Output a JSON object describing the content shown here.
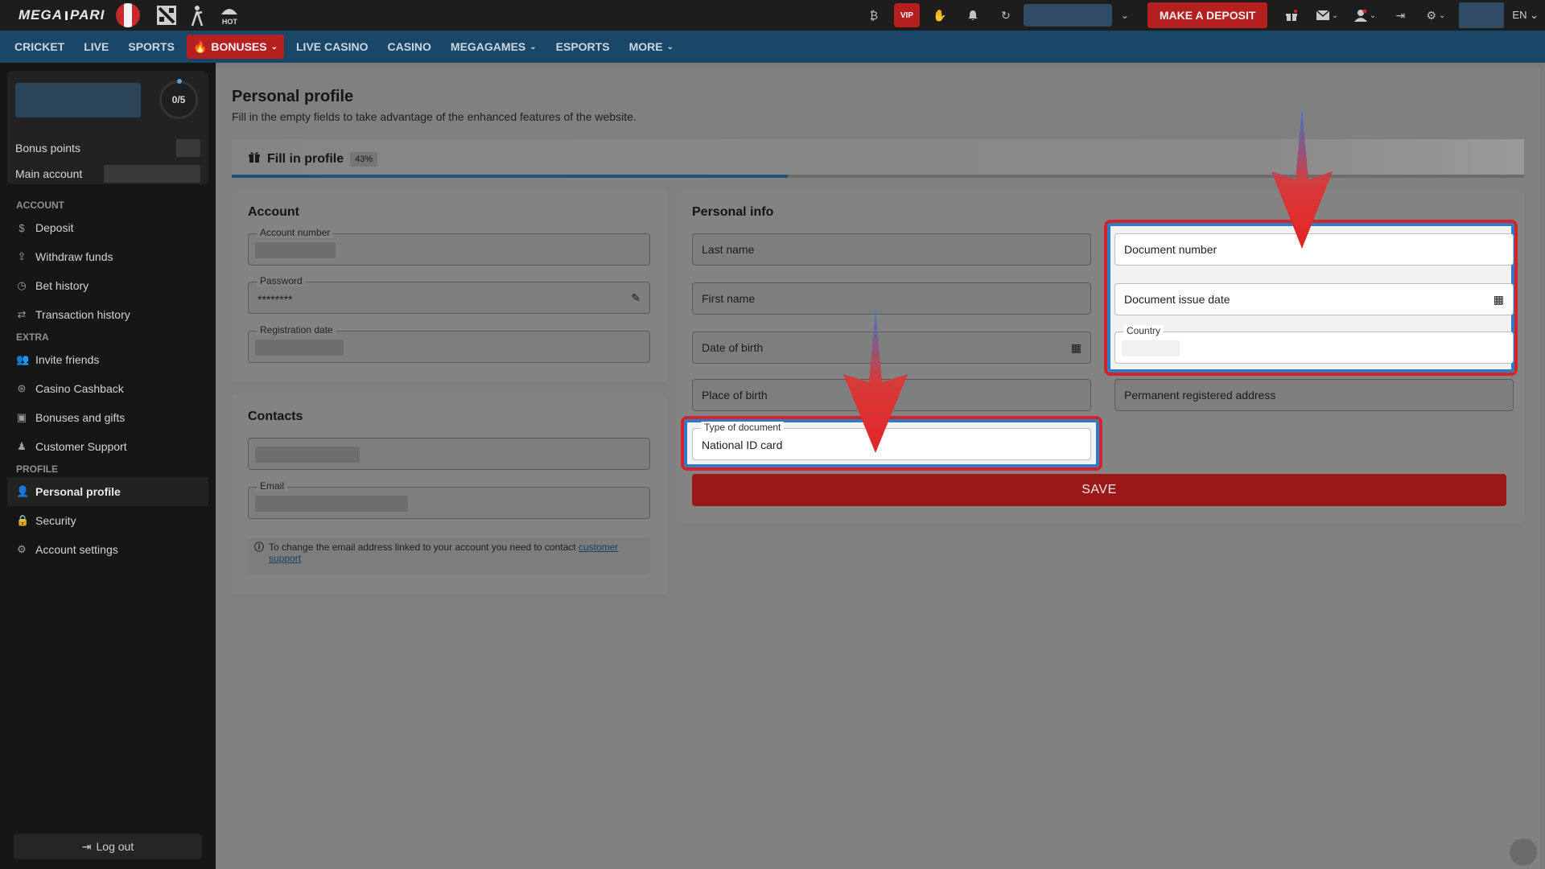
{
  "brand": {
    "logo_left": "MEGA",
    "logo_right": "PARI",
    "hot_label": "HOT"
  },
  "topbar": {
    "deposit_label": "MAKE A DEPOSIT",
    "vip_label": "VIP",
    "language": "EN",
    "icons": [
      "bitcoin-icon",
      "vip-icon",
      "hand-icon",
      "bell-icon",
      "refresh-icon",
      "gift-icon",
      "mail-icon",
      "user-icon",
      "logout-icon",
      "gear-icon"
    ]
  },
  "nav": {
    "items": [
      {
        "label": "CRICKET"
      },
      {
        "label": "LIVE"
      },
      {
        "label": "SPORTS"
      },
      {
        "label": "BONUSES",
        "active": true
      },
      {
        "label": "LIVE CASINO"
      },
      {
        "label": "CASINO"
      },
      {
        "label": "MEGAGAMES"
      },
      {
        "label": "ESPORTS"
      },
      {
        "label": "MORE"
      }
    ]
  },
  "sidebar": {
    "progress": "0/5",
    "bonus_points_label": "Bonus points",
    "main_account_label": "Main account",
    "sections": [
      {
        "title": "ACCOUNT",
        "items": [
          "Deposit",
          "Withdraw funds",
          "Bet history",
          "Transaction history"
        ]
      },
      {
        "title": "EXTRA",
        "items": [
          "Invite friends",
          "Casino Cashback",
          "Bonuses and gifts",
          "Customer Support"
        ]
      },
      {
        "title": "PROFILE",
        "items": [
          "Personal profile",
          "Security",
          "Account settings"
        ]
      }
    ],
    "active_item": "Personal profile",
    "logout_label": "Log out"
  },
  "page": {
    "title": "Personal profile",
    "subtitle": "Fill in the empty fields to take advantage of the enhanced features of the website.",
    "fill_tab_label": "Fill in profile",
    "fill_percent": "43%",
    "fill_fraction": 0.43
  },
  "account_card": {
    "title": "Account",
    "account_number_label": "Account number",
    "password_label": "Password",
    "password_value": "********",
    "registration_date_label": "Registration date"
  },
  "contacts_card": {
    "title": "Contacts",
    "email_label": "Email",
    "note_text": "To change the email address linked to your account you need to contact",
    "note_link": "customer support"
  },
  "personal_card": {
    "title": "Personal info",
    "last_name": "Last name",
    "first_name": "First name",
    "date_of_birth": "Date of birth",
    "place_of_birth": "Place of birth",
    "document_type_label": "Type of document",
    "document_type_value": "National ID card",
    "document_number": "Document number",
    "document_issue_date": "Document issue date",
    "country_label": "Country",
    "permanent_address": "Permanent registered address",
    "save_label": "SAVE"
  },
  "colors": {
    "accent_red": "#b51f1f",
    "nav_blue": "#1a4668",
    "highlight_border": "#d4232b",
    "highlight_inner": "#2f7ac4"
  }
}
